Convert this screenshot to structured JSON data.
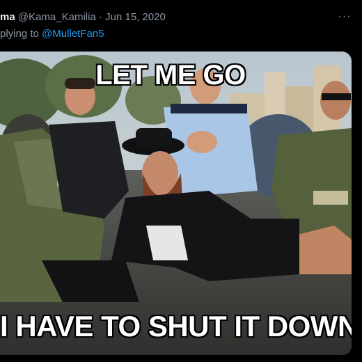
{
  "tweet": {
    "display_name": "ma",
    "handle": "@Kama_Kamilia",
    "separator": "·",
    "date": "Jun 15, 2020",
    "more_label": "···",
    "reply_prefix": "plying to",
    "reply_to": "@MulletFan5"
  },
  "meme": {
    "top_text": "LET ME GO",
    "bottom_text": "I HAVE TO SHUT IT DOWN"
  },
  "colors": {
    "background": "#000000",
    "text_primary": "#e7e9ea",
    "text_secondary": "#8b98a5",
    "link": "#1d9bf0"
  }
}
